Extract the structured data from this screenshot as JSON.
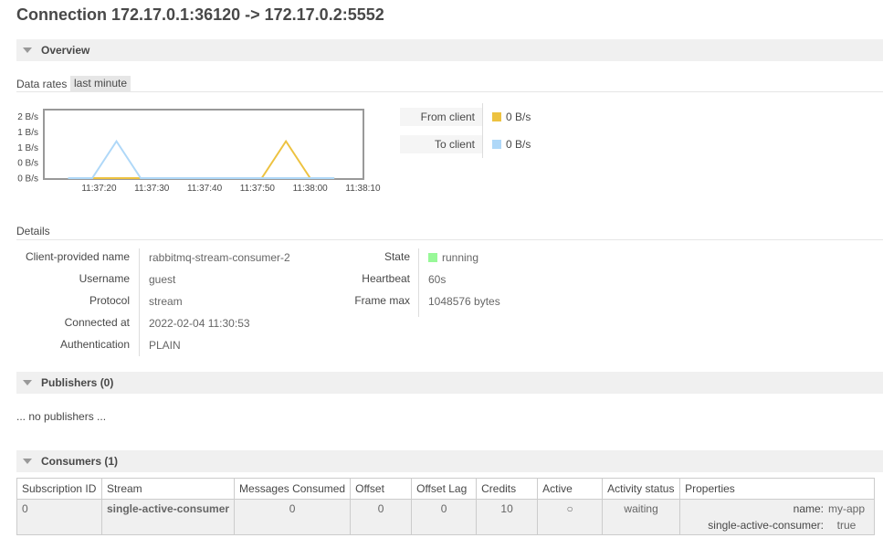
{
  "page": {
    "title": "Connection 172.17.0.1:36120 -> 172.17.0.2:5552"
  },
  "overview": {
    "section_title": "Overview",
    "data_rates_label": "Data rates",
    "range_tab": "last minute",
    "chart_data": {
      "type": "line",
      "ylabels": [
        "2 B/s",
        "1 B/s",
        "1 B/s",
        "0 B/s",
        "0 B/s"
      ],
      "xlabels": [
        "11:37:20",
        "11:37:30",
        "11:37:40",
        "11:37:50",
        "11:38:00",
        "11:38:10"
      ],
      "series": [
        {
          "name": "From client",
          "color": "#edc240",
          "points": [
            [
              5,
              0
            ],
            [
              10,
              0
            ],
            [
              40,
              0
            ],
            [
              45,
              0
            ],
            [
              50,
              1.2
            ],
            [
              55,
              0
            ],
            [
              60,
              0
            ]
          ]
        },
        {
          "name": "To client",
          "color": "#afd8f8",
          "points": [
            [
              5,
              0
            ],
            [
              10,
              0
            ],
            [
              15,
              1.2
            ],
            [
              20,
              0
            ],
            [
              60,
              0
            ]
          ]
        }
      ]
    },
    "legend": [
      {
        "label": "From client",
        "value": "0 B/s",
        "color": "#edc240"
      },
      {
        "label": "To client",
        "value": "0 B/s",
        "color": "#afd8f8"
      }
    ]
  },
  "details": {
    "heading": "Details",
    "left": [
      {
        "label": "Client-provided name",
        "value": "rabbitmq-stream-consumer-2"
      },
      {
        "label": "Username",
        "value": "guest"
      },
      {
        "label": "Protocol",
        "value": "stream"
      },
      {
        "label": "Connected at",
        "value": "2022-02-04 11:30:53"
      },
      {
        "label": "Authentication",
        "value": "PLAIN"
      }
    ],
    "right": [
      {
        "label": "State",
        "value": "running",
        "status_color": "#98f898"
      },
      {
        "label": "Heartbeat",
        "value": "60s"
      },
      {
        "label": "Frame max",
        "value": "1048576 bytes"
      }
    ]
  },
  "publishers": {
    "section_title": "Publishers (0)",
    "empty_text": "... no publishers ..."
  },
  "consumers": {
    "section_title": "Consumers (1)",
    "columns": [
      "Subscription ID",
      "Stream",
      "Messages Consumed",
      "Offset",
      "Offset Lag",
      "Credits",
      "Active",
      "Activity status",
      "Properties"
    ],
    "rows": [
      {
        "subscription_id": "0",
        "stream": "single-active-consumer",
        "messages_consumed": "0",
        "offset": "0",
        "offset_lag": "0",
        "credits": "10",
        "active": "○",
        "activity_status": "waiting",
        "properties": [
          {
            "key": "name:",
            "value": "my-app"
          },
          {
            "key": "single-active-consumer:",
            "value": "true"
          }
        ]
      }
    ]
  }
}
